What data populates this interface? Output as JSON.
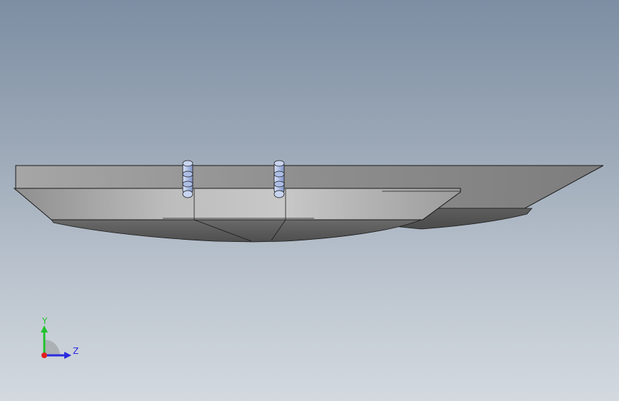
{
  "viewport": {
    "background_top": "#7d8ea3",
    "background_bottom": "#d3d9df"
  },
  "triad": {
    "y_label": "Y",
    "z_label": "Z",
    "y_color": "#22c22e",
    "z_color": "#2a2adf",
    "x_color": "#e02020"
  },
  "model": {
    "edge_color": "#1a1a1a",
    "pin_color": "#aebfe6"
  }
}
